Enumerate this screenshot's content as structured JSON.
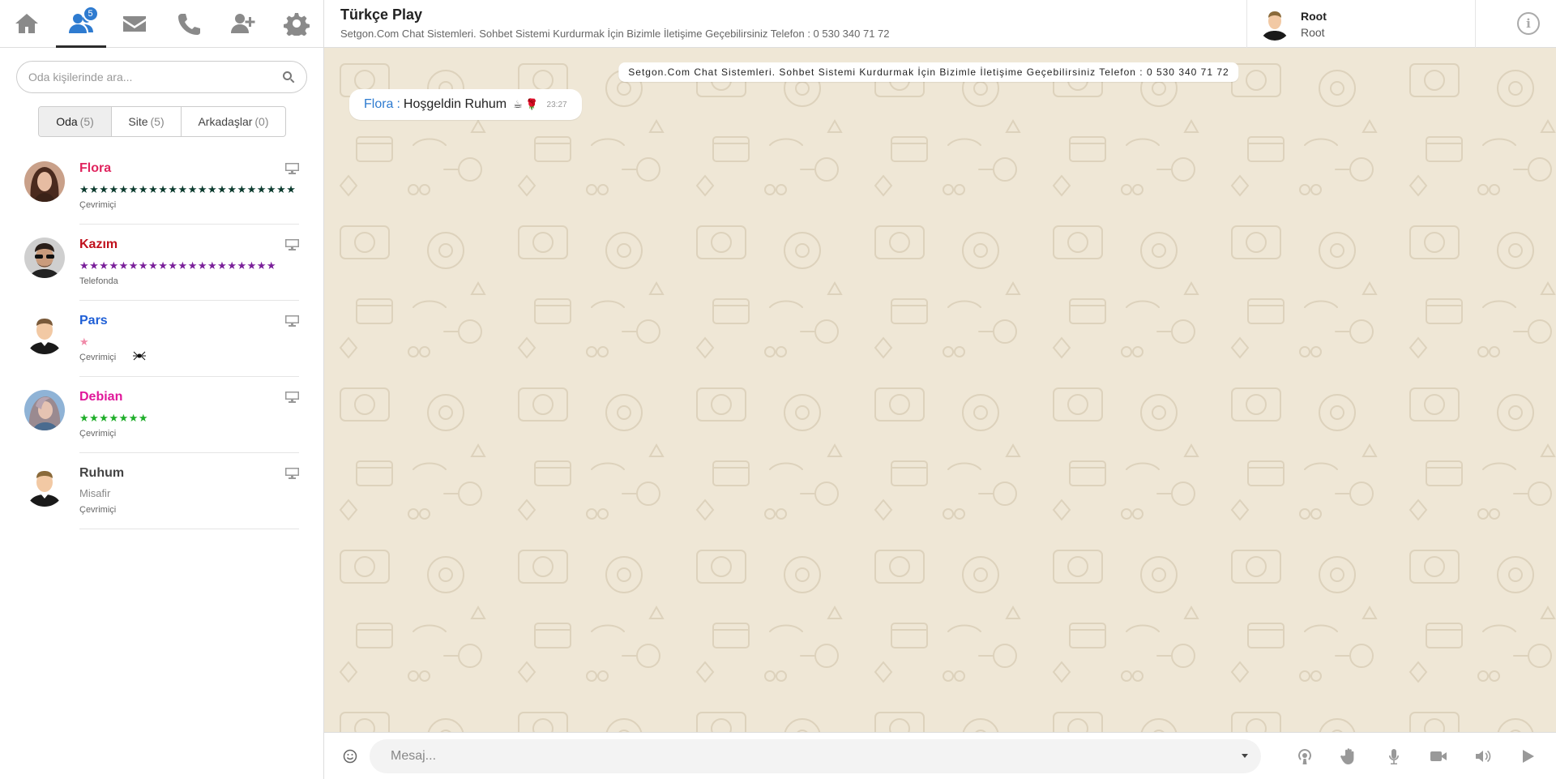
{
  "nav": {
    "badge_count": "5",
    "icons": [
      "home-icon",
      "users-icon",
      "envelope-icon",
      "phone-icon",
      "user-plus-icon",
      "gear-icon"
    ]
  },
  "search": {
    "placeholder": "Oda kişilerinde ara..."
  },
  "tabs": [
    {
      "label": "Oda",
      "count": "(5)"
    },
    {
      "label": "Site",
      "count": "(5)"
    },
    {
      "label": "Arkadaşlar",
      "count": "(0)"
    }
  ],
  "users": [
    {
      "name": "Flora",
      "name_color": "#e0245e",
      "stars": "★★★★★★★★★★★★★★★★★★★★★★",
      "stars_color": "#0b3b2e",
      "status": "Çevrimiçi"
    },
    {
      "name": "Kazım",
      "name_color": "#c0101c",
      "stars": "★★★★★★★★★★★★★★★★★★★★",
      "stars_color": "#7a1f9a",
      "status": "Telefonda"
    },
    {
      "name": "Pars",
      "name_color": "#1f5fd6",
      "stars": "★",
      "stars_color": "#f08aa8",
      "status": "Çevrimiçi"
    },
    {
      "name": "Debian",
      "name_color": "#e0189a",
      "stars": "★★★★★★★",
      "stars_color": "#1fae2a",
      "status": "Çevrimiçi"
    },
    {
      "name": "Ruhum",
      "name_color": "#444444",
      "sub": "Misafir",
      "status": "Çevrimiçi"
    }
  ],
  "header": {
    "title": "Türkçe Play",
    "subtitle": "Setgon.Com Chat Sistemleri. Sohbet Sistemi Kurdurmak İçin Bizimle İletişime Geçebilirsiniz Telefon : 0 530 340 71 72"
  },
  "profile": {
    "name": "Root",
    "role": "Root"
  },
  "info_label": "i",
  "chat": {
    "announcement": "Setgon.Com Chat Sistemleri. Sohbet Sistemi Kurdurmak İçin Bizimle İletişime Geçebilirsiniz Telefon : 0 530 340 71 72",
    "messages": [
      {
        "sender": "Flora",
        "separator": ":",
        "text": "Hoşgeldin Ruhum",
        "emoji": "☕ 🌹",
        "time": "23:27"
      }
    ]
  },
  "composer": {
    "placeholder": "Mesaj..."
  },
  "colors": {
    "accent": "#2e7bd0",
    "chat_bg": "#efe7d6"
  }
}
